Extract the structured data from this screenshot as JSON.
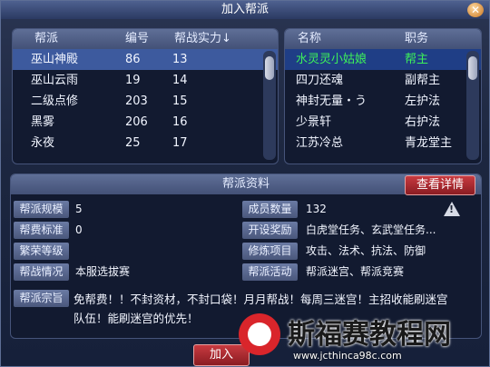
{
  "window": {
    "title": "加入帮派",
    "close_glyph": "✕"
  },
  "faction_list": {
    "headers": [
      "帮派",
      "编号",
      "帮战实力↓"
    ],
    "rows": [
      {
        "name": "巫山神殿",
        "id": "86",
        "power": "13"
      },
      {
        "name": "巫山云雨",
        "id": "19",
        "power": "14"
      },
      {
        "name": "二级点修",
        "id": "203",
        "power": "15"
      },
      {
        "name": "黑雾",
        "id": "206",
        "power": "16"
      },
      {
        "name": "永夜",
        "id": "25",
        "power": "17"
      }
    ]
  },
  "member_list": {
    "headers": [
      "名称",
      "职务"
    ],
    "rows": [
      {
        "name": "水灵灵小姑娘",
        "role": "帮主"
      },
      {
        "name": "四刀还魂",
        "role": "副帮主"
      },
      {
        "name": "神封无量・う",
        "role": "左护法"
      },
      {
        "name": "少景轩",
        "role": "右护法"
      },
      {
        "name": "江苏冷总",
        "role": "青龙堂主"
      }
    ]
  },
  "info": {
    "title": "帮派资料",
    "details_button": "查看详情",
    "scale_label": "帮派规模",
    "scale_value": "5",
    "fee_label": "帮费标准",
    "fee_value": "0",
    "prosper_label": "繁荣等级",
    "prosper_value": "",
    "war_label": "帮战情况",
    "war_value": "本服选拔赛",
    "members_label": "成员数量",
    "members_value": "132",
    "reward_label": "开设奖励",
    "reward_value": "白虎堂任务、玄武堂任务...",
    "train_label": "修炼项目",
    "train_value": "攻击、法术、抗法、防御",
    "activity_label": "帮派活动",
    "activity_value": "帮派迷宫、帮派竞赛",
    "motto_label": "帮派宗旨",
    "motto_value": "免帮费！！不封资材，不封口袋！月月帮战！每周三迷宫！主招收能刷迷宫队伍！能刷迷宫的优先！"
  },
  "join_button": "加入",
  "watermark": {
    "text": "斯福赛教程网",
    "url": "www.jcthinca98c.com"
  },
  "colors": {
    "selected_row": "#3d5a9e",
    "leader_green": "#3df05a",
    "button_red": "#c83a40"
  }
}
